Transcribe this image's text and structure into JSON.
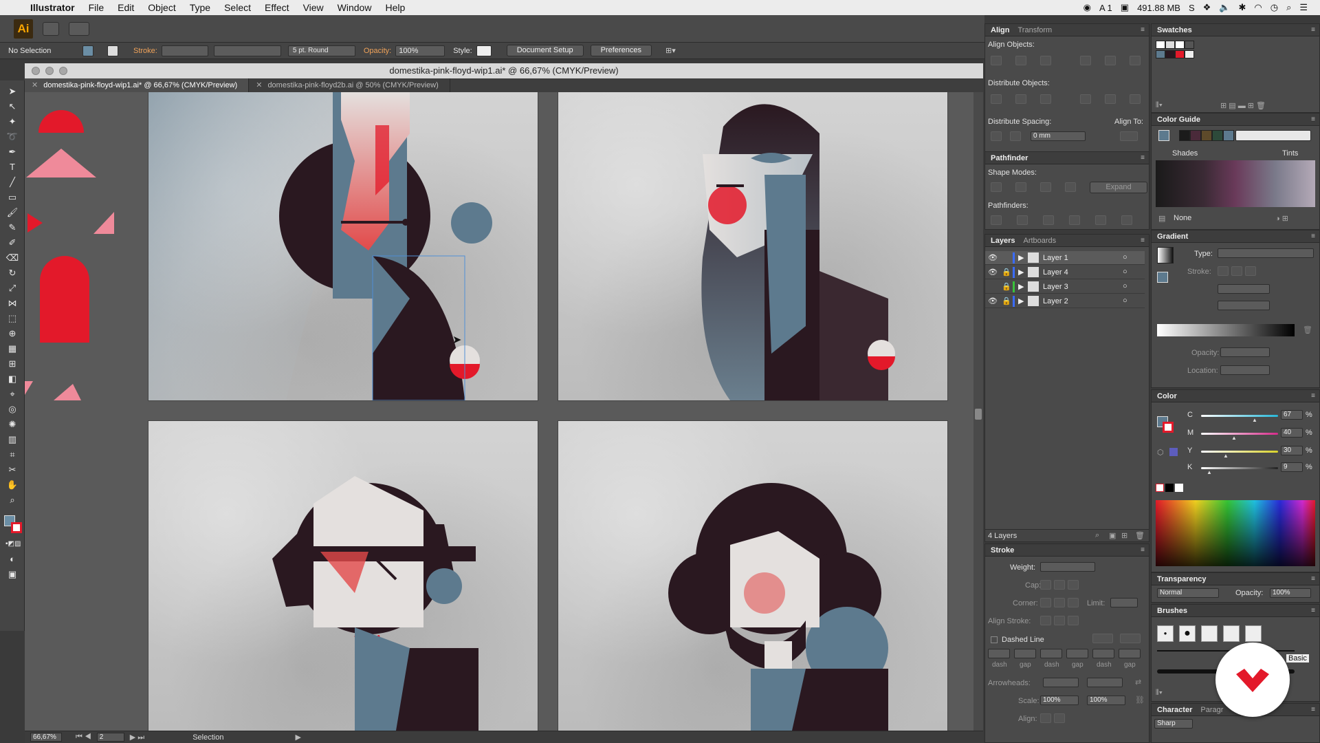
{
  "menubar": {
    "app_name": "Illustrator",
    "items": [
      "File",
      "Edit",
      "Object",
      "Type",
      "Select",
      "Effect",
      "View",
      "Window",
      "Help"
    ],
    "status_memory": "491.88 MB",
    "status_ai": "A 1"
  },
  "appbar": {
    "logo": "Ai"
  },
  "controlbar": {
    "selection": "No Selection",
    "stroke_label": "Stroke:",
    "brush": "5 pt. Round",
    "opacity_label": "Opacity:",
    "opacity_value": "100%",
    "style_label": "Style:",
    "document_setup": "Document Setup",
    "preferences": "Preferences"
  },
  "document": {
    "title": "domestika-pink-floyd-wip1.ai* @ 66,67% (CMYK/Preview)",
    "tabs": [
      {
        "label": "domestika-pink-floyd-wip1.ai* @ 66,67% (CMYK/Preview)",
        "active": true
      },
      {
        "label": "domestika-pink-floyd2b.ai @ 50% (CMYK/Preview)",
        "active": false
      }
    ]
  },
  "statusbar": {
    "zoom": "66,67%",
    "artboard": "2",
    "tool": "Selection"
  },
  "align_panel": {
    "tabs": [
      "Align",
      "Transform"
    ],
    "align_objects": "Align Objects:",
    "distribute_objects": "Distribute Objects:",
    "distribute_spacing": "Distribute Spacing:",
    "align_to": "Align To:",
    "spacing_value": "0 mm"
  },
  "pathfinder_panel": {
    "title": "Pathfinder",
    "shape_modes": "Shape Modes:",
    "expand": "Expand",
    "pathfinders": "Pathfinders:"
  },
  "layers_panel": {
    "tabs": [
      "Layers",
      "Artboards"
    ],
    "layers": [
      "Layer 1",
      "Layer 4",
      "Layer 3",
      "Layer 2"
    ],
    "layer_colors": [
      "#3a6bff",
      "#3a6bff",
      "#39c23a",
      "#3a6bff"
    ],
    "count": "4 Layers"
  },
  "stroke_panel": {
    "title": "Stroke",
    "weight": "Weight:",
    "cap": "Cap:",
    "corner": "Corner:",
    "limit": "Limit:",
    "align_stroke": "Align Stroke:",
    "dashed_line": "Dashed Line",
    "dash_labels": [
      "dash",
      "gap",
      "dash",
      "gap",
      "dash",
      "gap"
    ],
    "arrowheads": "Arrowheads:",
    "scale": "Scale:",
    "scale_values": [
      "100%",
      "100%"
    ],
    "align": "Align:"
  },
  "swatches_panel": {
    "title": "Swatches"
  },
  "color_guide_panel": {
    "title": "Color Guide",
    "shades": "Shades",
    "tints": "Tints",
    "none": "None"
  },
  "gradient_panel": {
    "title": "Gradient",
    "type": "Type:",
    "stroke": "Stroke:",
    "opacity": "Opacity:",
    "location": "Location:"
  },
  "color_panel": {
    "title": "Color",
    "channels": [
      {
        "label": "C",
        "value": "67",
        "pct": 67,
        "color": "#27b7d8"
      },
      {
        "label": "M",
        "value": "40",
        "pct": 40,
        "color": "#d62b8a"
      },
      {
        "label": "Y",
        "value": "30",
        "pct": 30,
        "color": "#d8d22b"
      },
      {
        "label": "K",
        "value": "9",
        "pct": 9,
        "color": "#222222"
      }
    ],
    "pct_sign": "%"
  },
  "transparency_panel": {
    "title": "Transparency",
    "mode": "Normal",
    "opacity_label": "Opacity:",
    "opacity_value": "100%"
  },
  "brushes_panel": {
    "title": "Brushes",
    "basic": "Basic"
  },
  "character_panel": {
    "tabs": [
      "Character",
      "Paragr"
    ],
    "aa": "Sharp"
  },
  "colors": {
    "accent_red": "#e3192a",
    "pink": "#ef8a9a",
    "slate": "#5d7a8e",
    "dark": "#2a1820",
    "skin": "#e4e0de"
  }
}
